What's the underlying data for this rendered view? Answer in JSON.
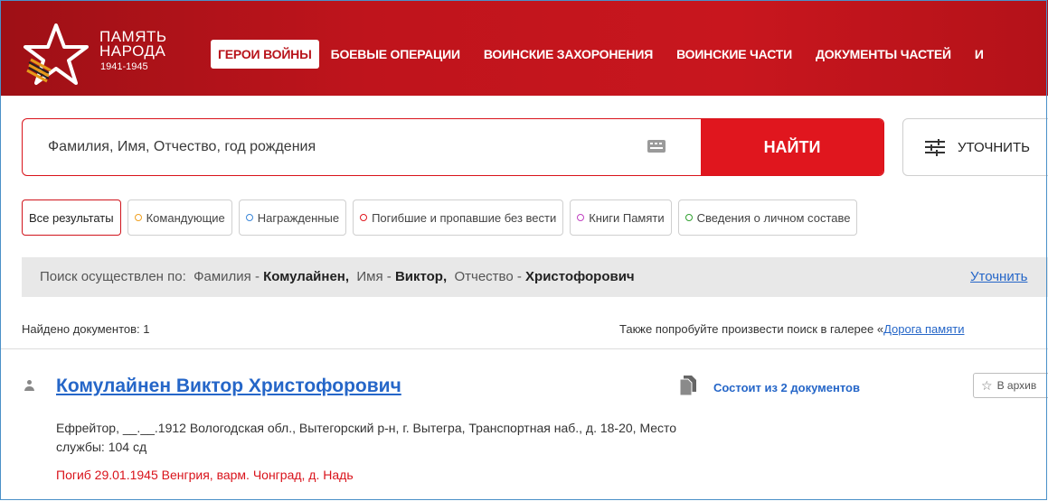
{
  "header": {
    "logo_line1": "ПАМЯТЬ",
    "logo_line2": "НАРОДА",
    "logo_years": "1941-1945",
    "nav": [
      "ГЕРОИ ВОЙНЫ",
      "БОЕВЫЕ ОПЕРАЦИИ",
      "ВОИНСКИЕ ЗАХОРОНЕНИЯ",
      "ВОИНСКИЕ ЧАСТИ",
      "ДОКУМЕНТЫ ЧАСТЕЙ",
      "И"
    ],
    "active_index": 0
  },
  "search": {
    "placeholder": "Фамилия, Имя, Отчество, год рождения",
    "submit_label": "НАЙТИ",
    "refine_label": "УТОЧНИТЬ"
  },
  "filters": [
    {
      "label": "Все результаты",
      "dot": null,
      "active": true
    },
    {
      "label": "Командующие",
      "dot": "#f0a020",
      "active": false
    },
    {
      "label": "Награжденные",
      "dot": "#3a86d8",
      "active": false
    },
    {
      "label": "Погибшие и пропавшие без вести",
      "dot": "#e0161e",
      "active": false
    },
    {
      "label": "Книги Памяти",
      "dot": "#c040c0",
      "active": false
    },
    {
      "label": "Сведения о личном составе",
      "dot": "#30a030",
      "active": false
    }
  ],
  "query": {
    "prefix": "Поиск осуществлен по:",
    "surname_label": "Фамилия -",
    "surname": "Комулайнен,",
    "name_label": "Имя -",
    "name": "Виктор,",
    "patronymic_label": "Отчество -",
    "patronymic": "Христофорович",
    "refine_link": "Уточнить"
  },
  "results_meta": {
    "found": "Найдено документов: 1",
    "also_text": "Также попробуйте произвести поиск в галерее «",
    "also_link": "Дорога памяти"
  },
  "result": {
    "name": "Комулайнен Виктор Христофорович",
    "docs": "Состоит из 2 документов",
    "archive": "В архив",
    "details": "Ефрейтор, __.__.1912 Вологодская обл., Вытегорский р-н, г. Вытегра, Транспортная наб., д. 18-20, Место службы: 104 сд",
    "death": "Погиб 29.01.1945 Венгрия, варм. Чонград, д. Надь"
  },
  "colors": {
    "brand_red": "#c8161e",
    "button_red": "#e0161e",
    "link_blue": "#2566c8"
  }
}
